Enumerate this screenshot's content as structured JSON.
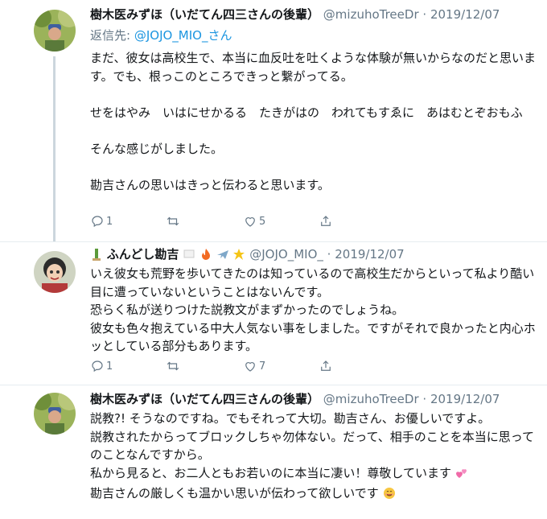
{
  "tweets": [
    {
      "name": "樹木医みずほ（いだてん四三さんの後輩）",
      "handle": "@mizuhoTreeDr",
      "date": "2019/12/07",
      "reply_label": "返信先:",
      "reply_mention": "@JOJO_MIO_さん",
      "body": "まだ、彼女は高校生で、本当に血反吐を吐くような体験が無いからなのだと思います。でも、根っこのところできっと繋がってる。\n\nせをはやみ　いはにせかるる　たきがはの　われてもすゑに　あはむとぞおもふ\n\nそんな感じがしました。\n\n勘吉さんの思いはきっと伝わると思います。",
      "reply_count": "1",
      "retweet_count": "",
      "like_count": "5"
    },
    {
      "name": "ふんどし勘吉",
      "handle": "@JOJO_MIO_",
      "date": "2019/12/07",
      "body": "いえ彼女も荒野を歩いてきたのは知っているので高校生だからといって私より酷い目に遭っていないということはないんです。\n恐らく私が送りつけた説教文がまずかったのでしょうね。\n彼女も色々抱えている中大人気ない事をしました。ですがそれで良かったと内心ホッとしている部分もあります。",
      "reply_count": "1",
      "retweet_count": "",
      "like_count": "7"
    },
    {
      "name": "樹木医みずほ（いだてん四三さんの後輩）",
      "handle": "@mizuhoTreeDr",
      "date": "2019/12/07",
      "body_lines": [
        "説教?! そうなのですね。でもそれって大切。勘吉さん、お優しいですよ。",
        "説教されたからってブロックしちゃ勿体ない。だって、相手のことを本当に思ってのことなんですから。",
        "私から見ると、お二人ともお若いのに本当に凄い！尊敬しています",
        "勘吉さんの厳しくも温かい思いが伝わって欲しいです"
      ]
    }
  ],
  "colors": {
    "text": "#14171a",
    "secondary": "#657786",
    "link": "#1b95e0",
    "line": "#ccd6dd"
  },
  "icons": [
    "reply-icon",
    "retweet-icon",
    "like-icon",
    "share-icon",
    "bamboo-emoji",
    "flag-emoji",
    "fire-emoji",
    "airplane-emoji",
    "star-emoji",
    "hearts-emoji",
    "smile-emoji"
  ]
}
